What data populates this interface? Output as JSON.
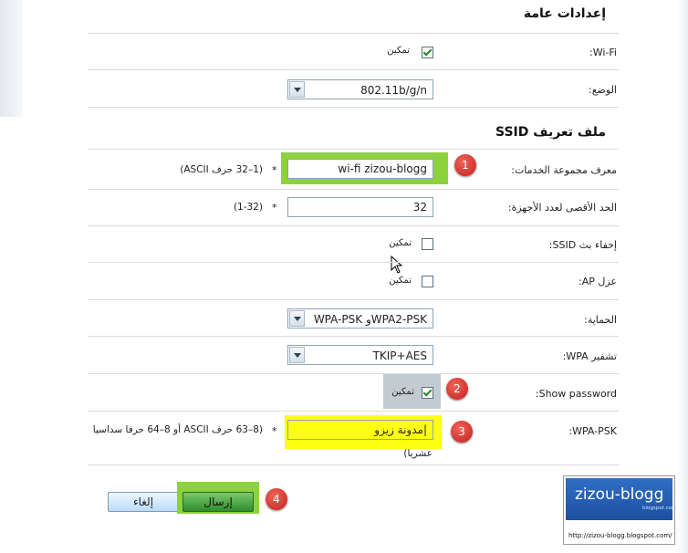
{
  "general_section": {
    "title": "إعدادات عامة"
  },
  "wifi": {
    "label": "Wi-Fi:",
    "enable_label": "تمكين",
    "checked": true
  },
  "mode": {
    "label": "الوضع:",
    "value": "802.11b/g/n"
  },
  "ssid_section": {
    "title": "ملف تعريف SSID"
  },
  "ssid": {
    "label": "معرف مجموعة الخدمات:",
    "value": "wi-fi zizou-blogg",
    "required": "*",
    "hint": "(1–32 حرف ASCII)"
  },
  "max_devices": {
    "label": "الحد الأقصى لعدد الأجهزة:",
    "value": "32",
    "required": "*",
    "hint": "(1-32)"
  },
  "hide_ssid": {
    "label": "إخفاء بث SSID:",
    "enable_label": "تمكين",
    "checked": false
  },
  "ap_isolation": {
    "label": "عزل AP:",
    "enable_label": "تمكين",
    "checked": false
  },
  "security": {
    "label": "الحماية:",
    "value": "WPA-PSK وWPA2-PSK"
  },
  "wpa_encryption": {
    "label": "تشفير WPA:",
    "value": "TKIP+AES"
  },
  "show_password": {
    "label": "Show password:",
    "enable_label": "تمكين",
    "checked": true
  },
  "wpa_psk": {
    "label": "WPA-PSK:",
    "value": "مدونة زيزو|",
    "required": "*",
    "hint_line1": "(8–63 حرف ASCII أو 8–64 حرفا سداسيا",
    "hint_line2": "عشريا)"
  },
  "buttons": {
    "cancel_label": "إلغاء",
    "submit_label": "إرسال"
  },
  "annotations": [
    "1",
    "2",
    "3",
    "4"
  ],
  "watermark": {
    "title": "zizou-blogg",
    "subtitle": "blogspot.com",
    "url": "http://zizou-blogg.blogspot.com/"
  },
  "colors": {
    "highlight_green": "#8dd13d",
    "highlight_yellow": "#ffff14",
    "badge_red": "#d8322a",
    "logo_blue": "#2a62b8"
  }
}
